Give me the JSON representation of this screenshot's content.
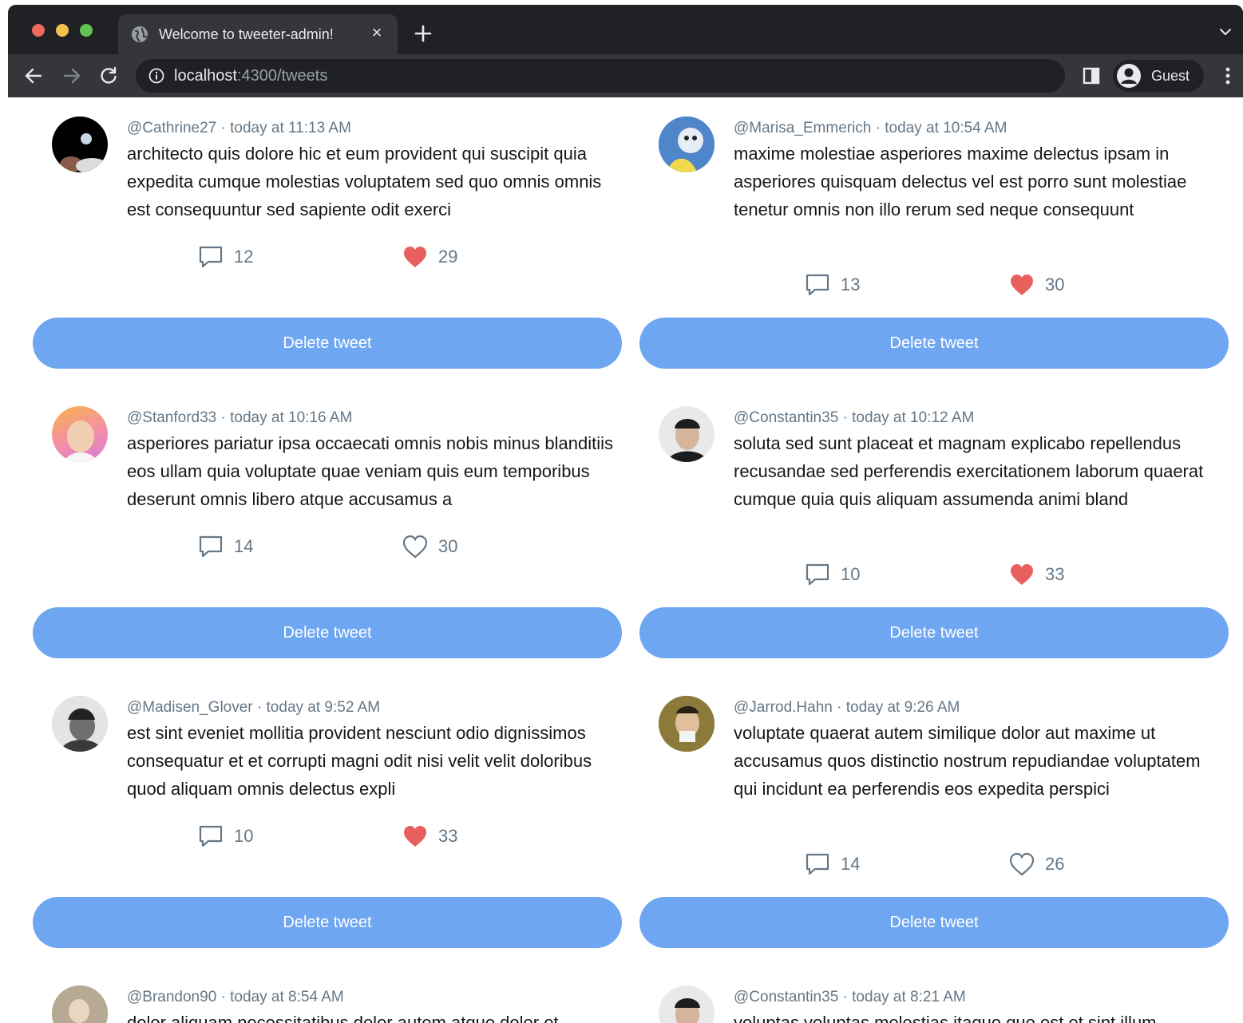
{
  "browser": {
    "tab_title": "Welcome to tweeter-admin!",
    "tab_close": "×",
    "url_host": "localhost",
    "url_rest": ":4300/tweets",
    "profile_label": "Guest"
  },
  "colors": {
    "accent_button": "#6ea6f1",
    "like_filled": "#e8605d",
    "meta_text": "#657786"
  },
  "delete_label": "Delete tweet",
  "tweets": [
    {
      "handle": "@Cathrine27",
      "time": "today at 11:13 AM",
      "text": "architecto quis dolore hic et eum provident qui suscipit quia expedita cumque molestias voluptatem sed quo omnis omnis est consequuntur sed sapiente odit exerci",
      "replies": "12",
      "likes": "29",
      "liked": true
    },
    {
      "handle": "@Marisa_Emmerich",
      "time": "today at 10:54 AM",
      "text": "maxime molestiae asperiores maxime delectus ipsam in asperiores quisquam delectus vel est porro sunt molestiae tenetur omnis non illo rerum sed neque consequunt",
      "replies": "13",
      "likes": "30",
      "liked": true
    },
    {
      "handle": "@Stanford33",
      "time": "today at 10:16 AM",
      "text": "asperiores pariatur ipsa occaecati omnis nobis minus blanditiis eos ullam quia voluptate quae veniam quis eum temporibus deserunt omnis libero atque accusamus a",
      "replies": "14",
      "likes": "30",
      "liked": false
    },
    {
      "handle": "@Constantin35",
      "time": "today at 10:12 AM",
      "text": "soluta sed sunt placeat et magnam explicabo repellendus recusandae sed perferendis exercitationem laborum quaerat cumque quia quis aliquam assumenda animi bland",
      "replies": "10",
      "likes": "33",
      "liked": true
    },
    {
      "handle": "@Madisen_Glover",
      "time": "today at 9:52 AM",
      "text": "est sint eveniet mollitia provident nesciunt odio dignissimos consequatur et et corrupti magni odit nisi velit velit doloribus quod aliquam omnis delectus expli",
      "replies": "10",
      "likes": "33",
      "liked": true
    },
    {
      "handle": "@Jarrod.Hahn",
      "time": "today at 9:26 AM",
      "text": "voluptate quaerat autem similique dolor aut maxime ut accusamus quos distinctio nostrum repudiandae voluptatem qui incidunt ea perferendis eos expedita perspici",
      "replies": "14",
      "likes": "26",
      "liked": false
    },
    {
      "handle": "@Brandon90",
      "time": "today at 8:54 AM",
      "text": "dolor aliquam necessitatibus dolor autem atque dolor et",
      "replies": "",
      "likes": "",
      "liked": false
    },
    {
      "handle": "@Constantin35",
      "time": "today at 8:21 AM",
      "text": "voluptas voluptas molestias itaque quo est et sint illum",
      "replies": "",
      "likes": "",
      "liked": false
    }
  ]
}
